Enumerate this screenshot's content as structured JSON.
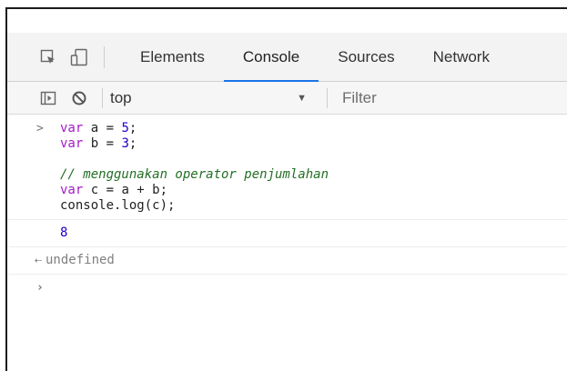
{
  "toolbar_icons": {
    "inspect": "inspect-element-icon",
    "device": "device-toolbar-icon",
    "sidebar": "show-sidebar-icon",
    "clear": "clear-console-icon"
  },
  "tabs": [
    {
      "label": "Elements",
      "active": false
    },
    {
      "label": "Console",
      "active": true
    },
    {
      "label": "Sources",
      "active": false
    },
    {
      "label": "Network",
      "active": false
    }
  ],
  "console_toolbar": {
    "context": "top",
    "filter_placeholder": "Filter"
  },
  "console": {
    "input_prompt": ">",
    "code": {
      "l1_kw": "var",
      "l1_rest": " a = ",
      "l1_num": "5",
      "l1_end": ";",
      "l2_kw": "var",
      "l2_rest": " b = ",
      "l2_num": "3",
      "l2_end": ";",
      "comment": "// menggunakan operator penjumlahan",
      "l5_kw": "var",
      "l5_rest": " c = a + b;",
      "l6": "console.log(c);"
    },
    "log_output": "8",
    "return_prompt": "⇠",
    "return_value": "undefined",
    "active_prompt": "›"
  },
  "colors": {
    "keyword": "#a31ac9",
    "number": "#1c00cf",
    "comment": "#236e25",
    "active_tab_underline": "#1a73e8"
  }
}
